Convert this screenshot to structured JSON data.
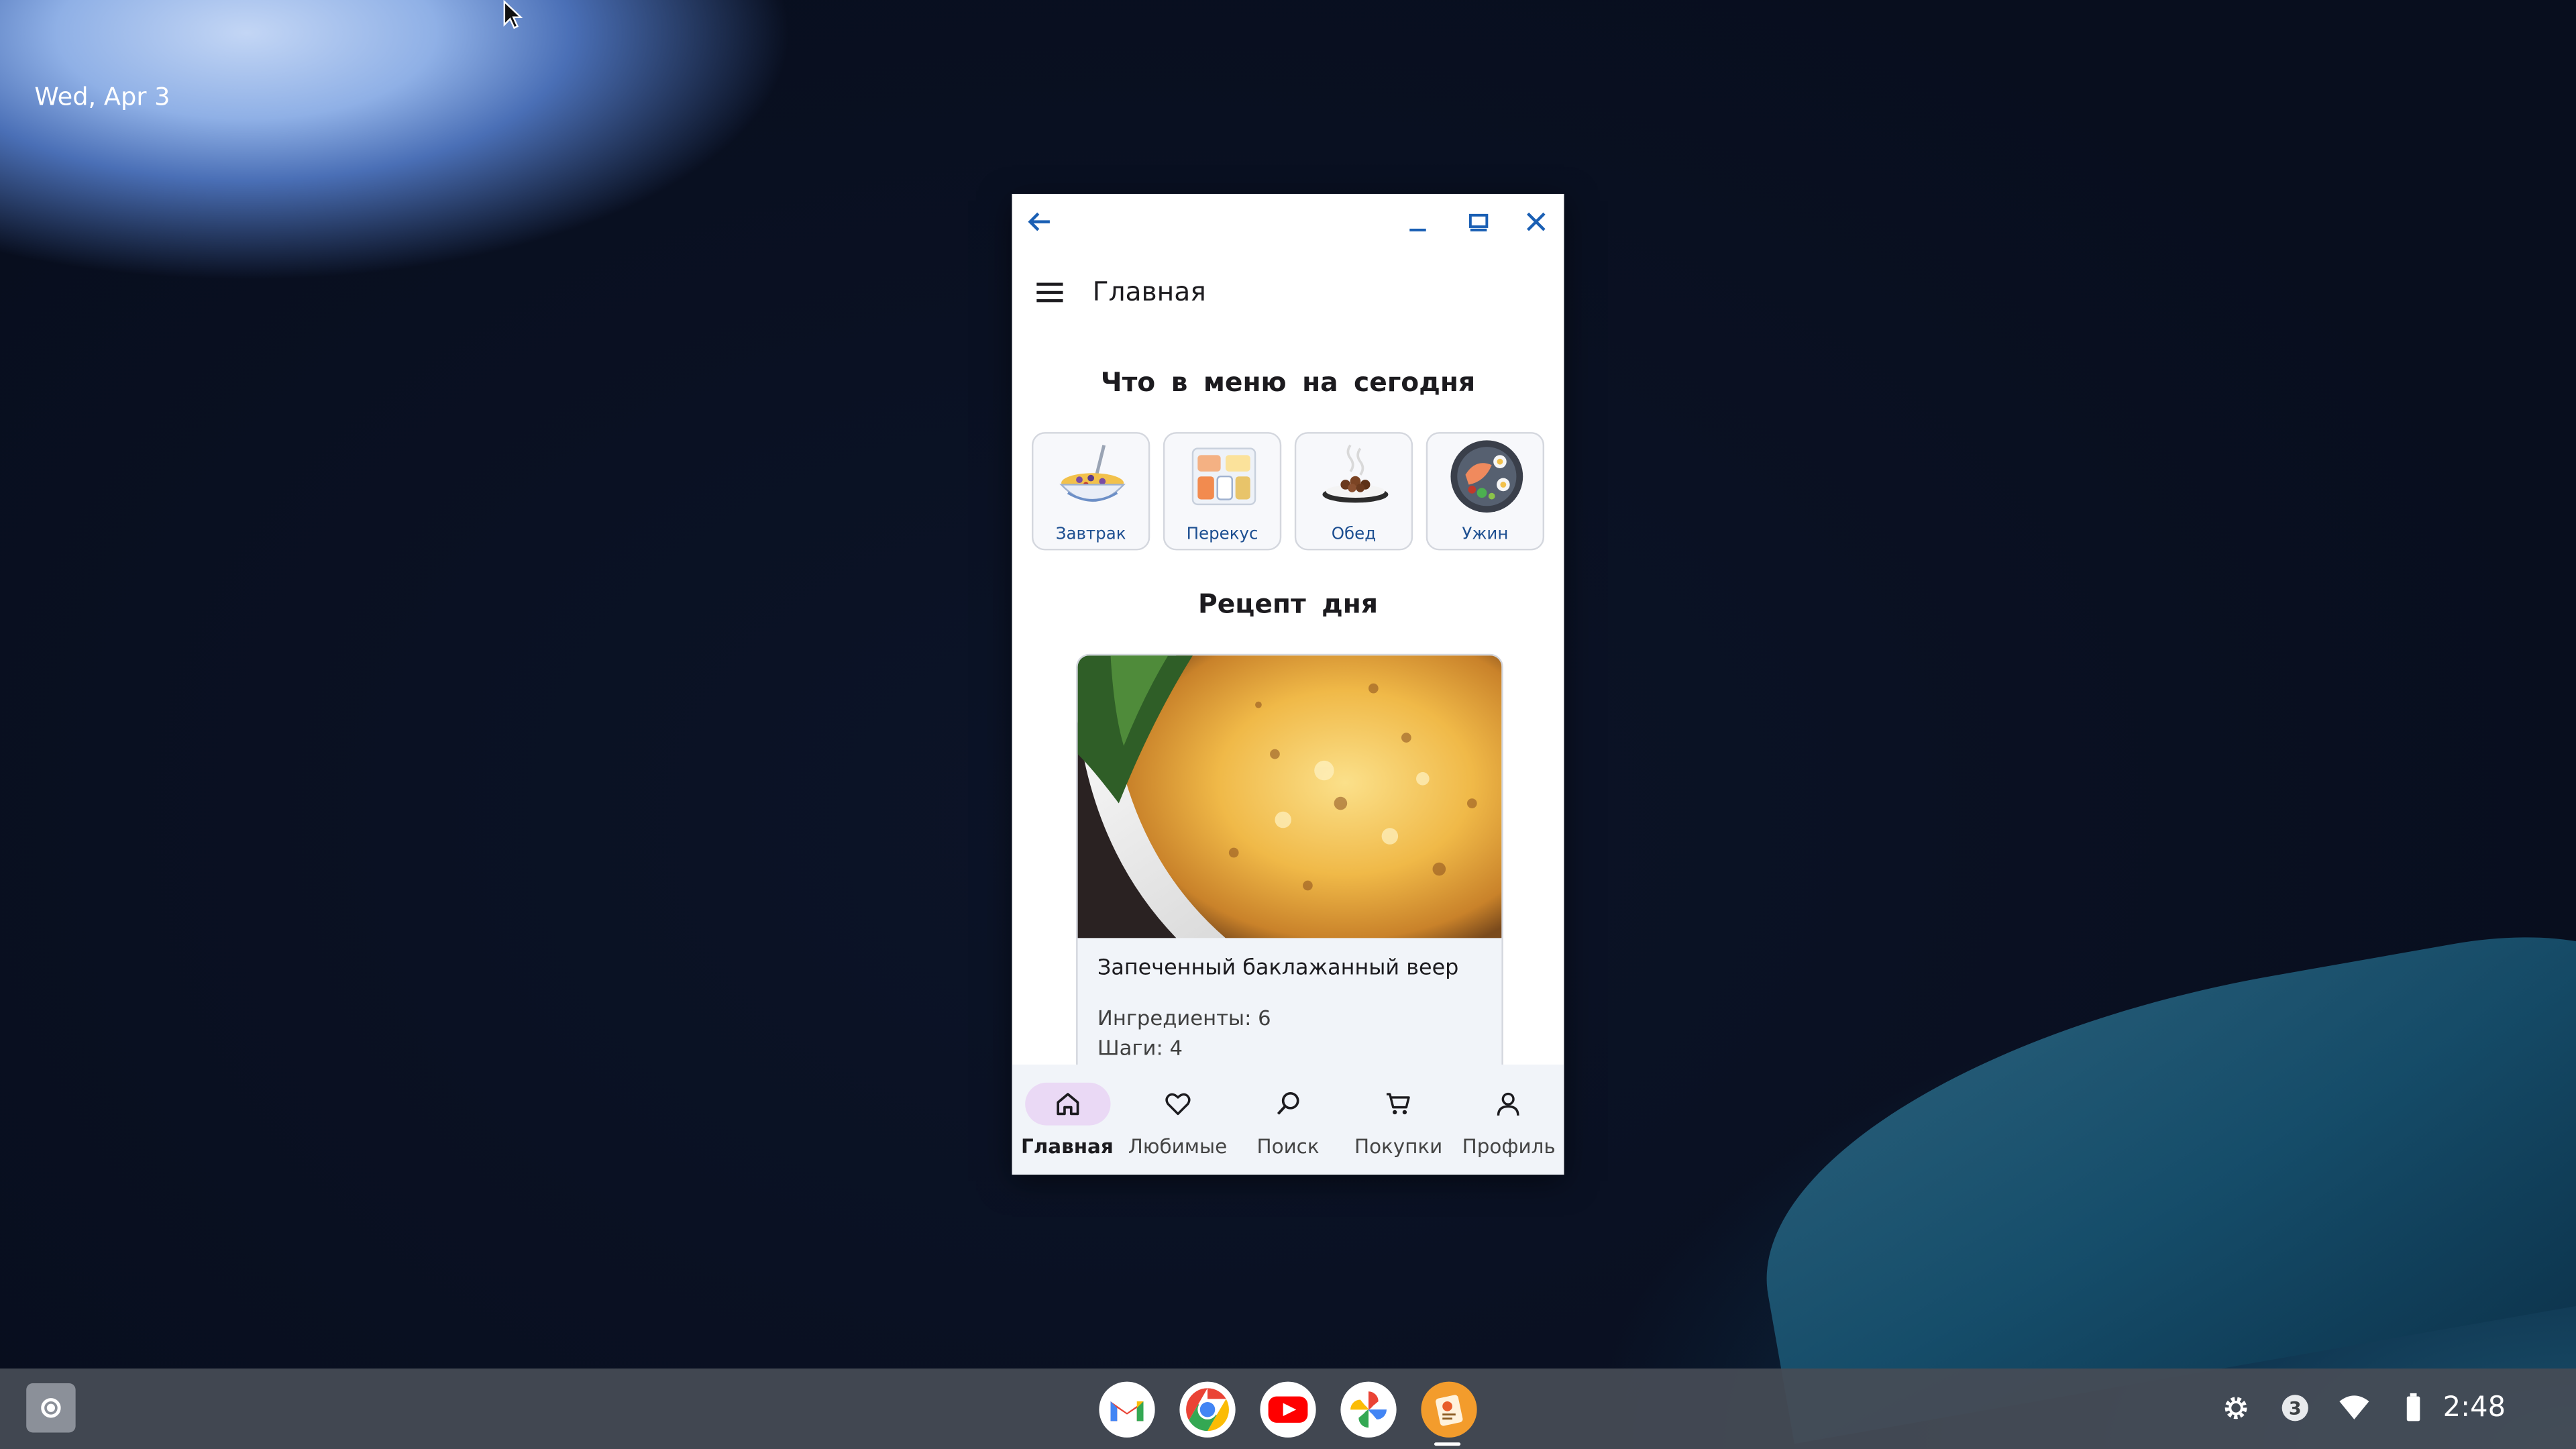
{
  "desktop": {
    "date": "Wed, Apr 3"
  },
  "window": {
    "app_bar_title": "Главная",
    "section_today": "Что в меню на сегодня",
    "meals": [
      {
        "label": "Завтрак",
        "icon": "breakfast-bowl"
      },
      {
        "label": "Перекус",
        "icon": "snack-tray"
      },
      {
        "label": "Обед",
        "icon": "lunch-plate"
      },
      {
        "label": "Ужин",
        "icon": "dinner-plate"
      }
    ],
    "section_recipe": "Рецепт дня",
    "recipe": {
      "name": "Запеченный баклажанный веер",
      "ingredients": "Ингредиенты: 6",
      "steps": "Шаги: 4"
    },
    "bottom_nav": [
      {
        "label": "Главная",
        "icon": "home-icon",
        "active": true
      },
      {
        "label": "Любимые",
        "icon": "heart-icon",
        "active": false
      },
      {
        "label": "Поиск",
        "icon": "search-icon",
        "active": false
      },
      {
        "label": "Покупки",
        "icon": "cart-icon",
        "active": false
      },
      {
        "label": "Профиль",
        "icon": "person-icon",
        "active": false
      }
    ],
    "colors": {
      "accent": "#1a5fb4",
      "nav_background": "#f1f4f9",
      "active_pill": "#ead9f5"
    }
  },
  "shelf": {
    "apps": [
      "Gmail",
      "Chrome",
      "YouTube",
      "Photos",
      "Recipe app"
    ],
    "notification_count": "3",
    "time": "2:48"
  }
}
